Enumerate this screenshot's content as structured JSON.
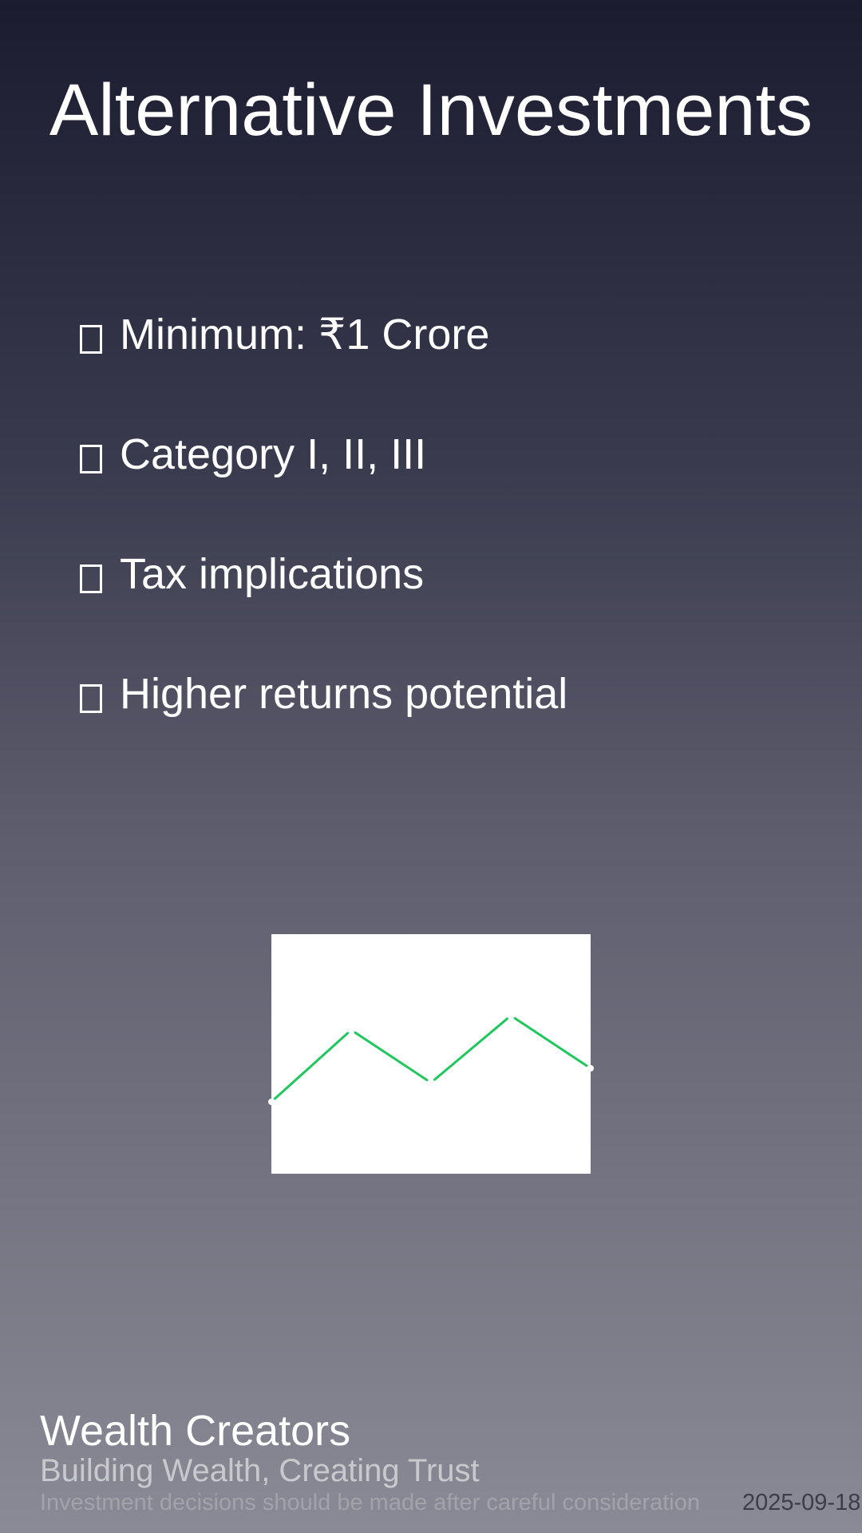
{
  "title": "Alternative Investments",
  "bullets": [
    {
      "icon": "checkbox-icon",
      "label": "Minimum: ₹1 Crore"
    },
    {
      "icon": "checkbox-icon",
      "label": "Category I, II, III"
    },
    {
      "icon": "checkbox-icon",
      "label": "Tax implications"
    },
    {
      "icon": "checkbox-icon",
      "label": "Higher returns potential"
    }
  ],
  "chart_data": {
    "type": "line",
    "title": "",
    "xlabel": "",
    "ylabel": "",
    "x": [
      0,
      1,
      2,
      3,
      4
    ],
    "values": [
      30,
      60,
      38,
      66,
      44
    ],
    "ylim": [
      0,
      100
    ],
    "grid": false,
    "line_color": "#22c55e",
    "background": "#ffffff"
  },
  "footer": {
    "brand": "Wealth Creators",
    "tagline": "Building Wealth, Creating Trust",
    "disclaimer": "Investment decisions should be made after careful consideration",
    "date": "2025-09-18"
  }
}
